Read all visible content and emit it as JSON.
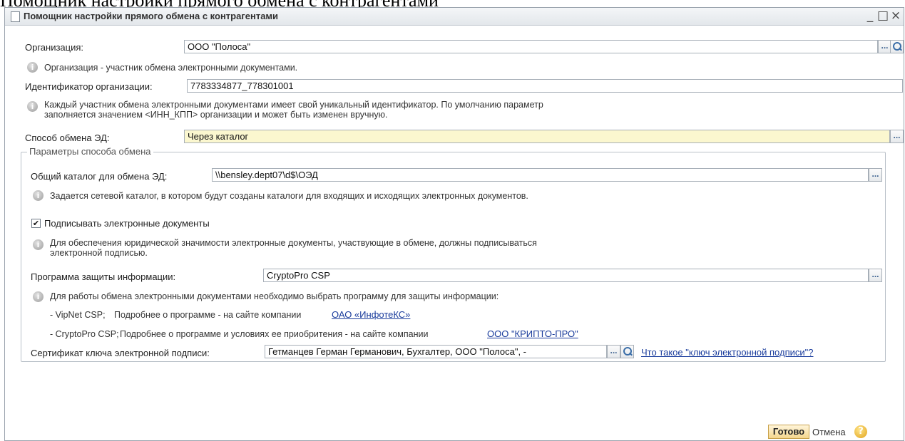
{
  "caption": "Помощник настройки прямого обмена с контрагентами",
  "window": {
    "title": "Помощник настройки прямого обмена с контрагентами",
    "minimize": "_",
    "maximize": "□",
    "close": "×"
  },
  "form": {
    "organization": {
      "label": "Организация:",
      "value": "ООО \"Полоса\"",
      "hint": "Организация - участник обмена электронными документами."
    },
    "org_id": {
      "label": "Идентификатор организации:",
      "value": "7783334877_778301001",
      "hint_line1": "Каждый участник обмена электронными документами имеет свой уникальный идентификатор. По умолчанию параметр",
      "hint_line2": "заполняется значением <ИНН_КПП> организации и может быть изменен вручную."
    },
    "exchange_method": {
      "label": "Способ обмена ЭД:",
      "value": "Через каталог"
    },
    "params_group": {
      "title": "Параметры способа обмена",
      "shared_dir": {
        "label": "Общий каталог для обмена ЭД:",
        "value": "\\\\bensley.dept07\\d$\\ОЭД",
        "hint": "Задается сетевой каталог, в котором будут созданы каталоги для входящих и исходящих электронных документов."
      },
      "sign": {
        "checked": true,
        "label": "Подписывать электронные документы",
        "hint_line1": "Для обеспечения юридической значимости электронные документы, участвующие в обмене, должны подписываться",
        "hint_line2": "электронной подписью."
      },
      "crypto": {
        "label": "Программа защиты информации:",
        "value": "CryptoPro CSP",
        "hint": "Для работы обмена электронными документами необходимо выбрать программу для защиты информации:",
        "vipnet_label": "- VipNet CSP;",
        "vipnet_text": "Подробнее о программе - на сайте компании",
        "vipnet_link": "ОАО «ИнфотеКС»",
        "cryptopro_label": "- CryptoPro CSP;",
        "cryptopro_text": "Подробнее о программе и условиях ее приобритения - на сайте компании",
        "cryptopro_link": "ООО \"КРИПТО-ПРО\""
      },
      "certificate": {
        "label": "Сертификат ключа электронной подписи:",
        "value": "Гетманцев Герман Германович, Бухгалтер, ООО \"Полоса\", -",
        "help_link": "Что такое \"ключ электронной подписи\"?"
      }
    }
  },
  "buttons": {
    "done": "Готово",
    "cancel": "Отмена",
    "help": "?"
  },
  "icons": {
    "info": "info-icon",
    "search": "search-icon",
    "document": "document-icon",
    "help": "help-icon",
    "check": "check-icon"
  },
  "colors": {
    "yellow_field": "#fbf7cf",
    "done_button": "#f4d68d",
    "link": "#1a3c9c"
  }
}
